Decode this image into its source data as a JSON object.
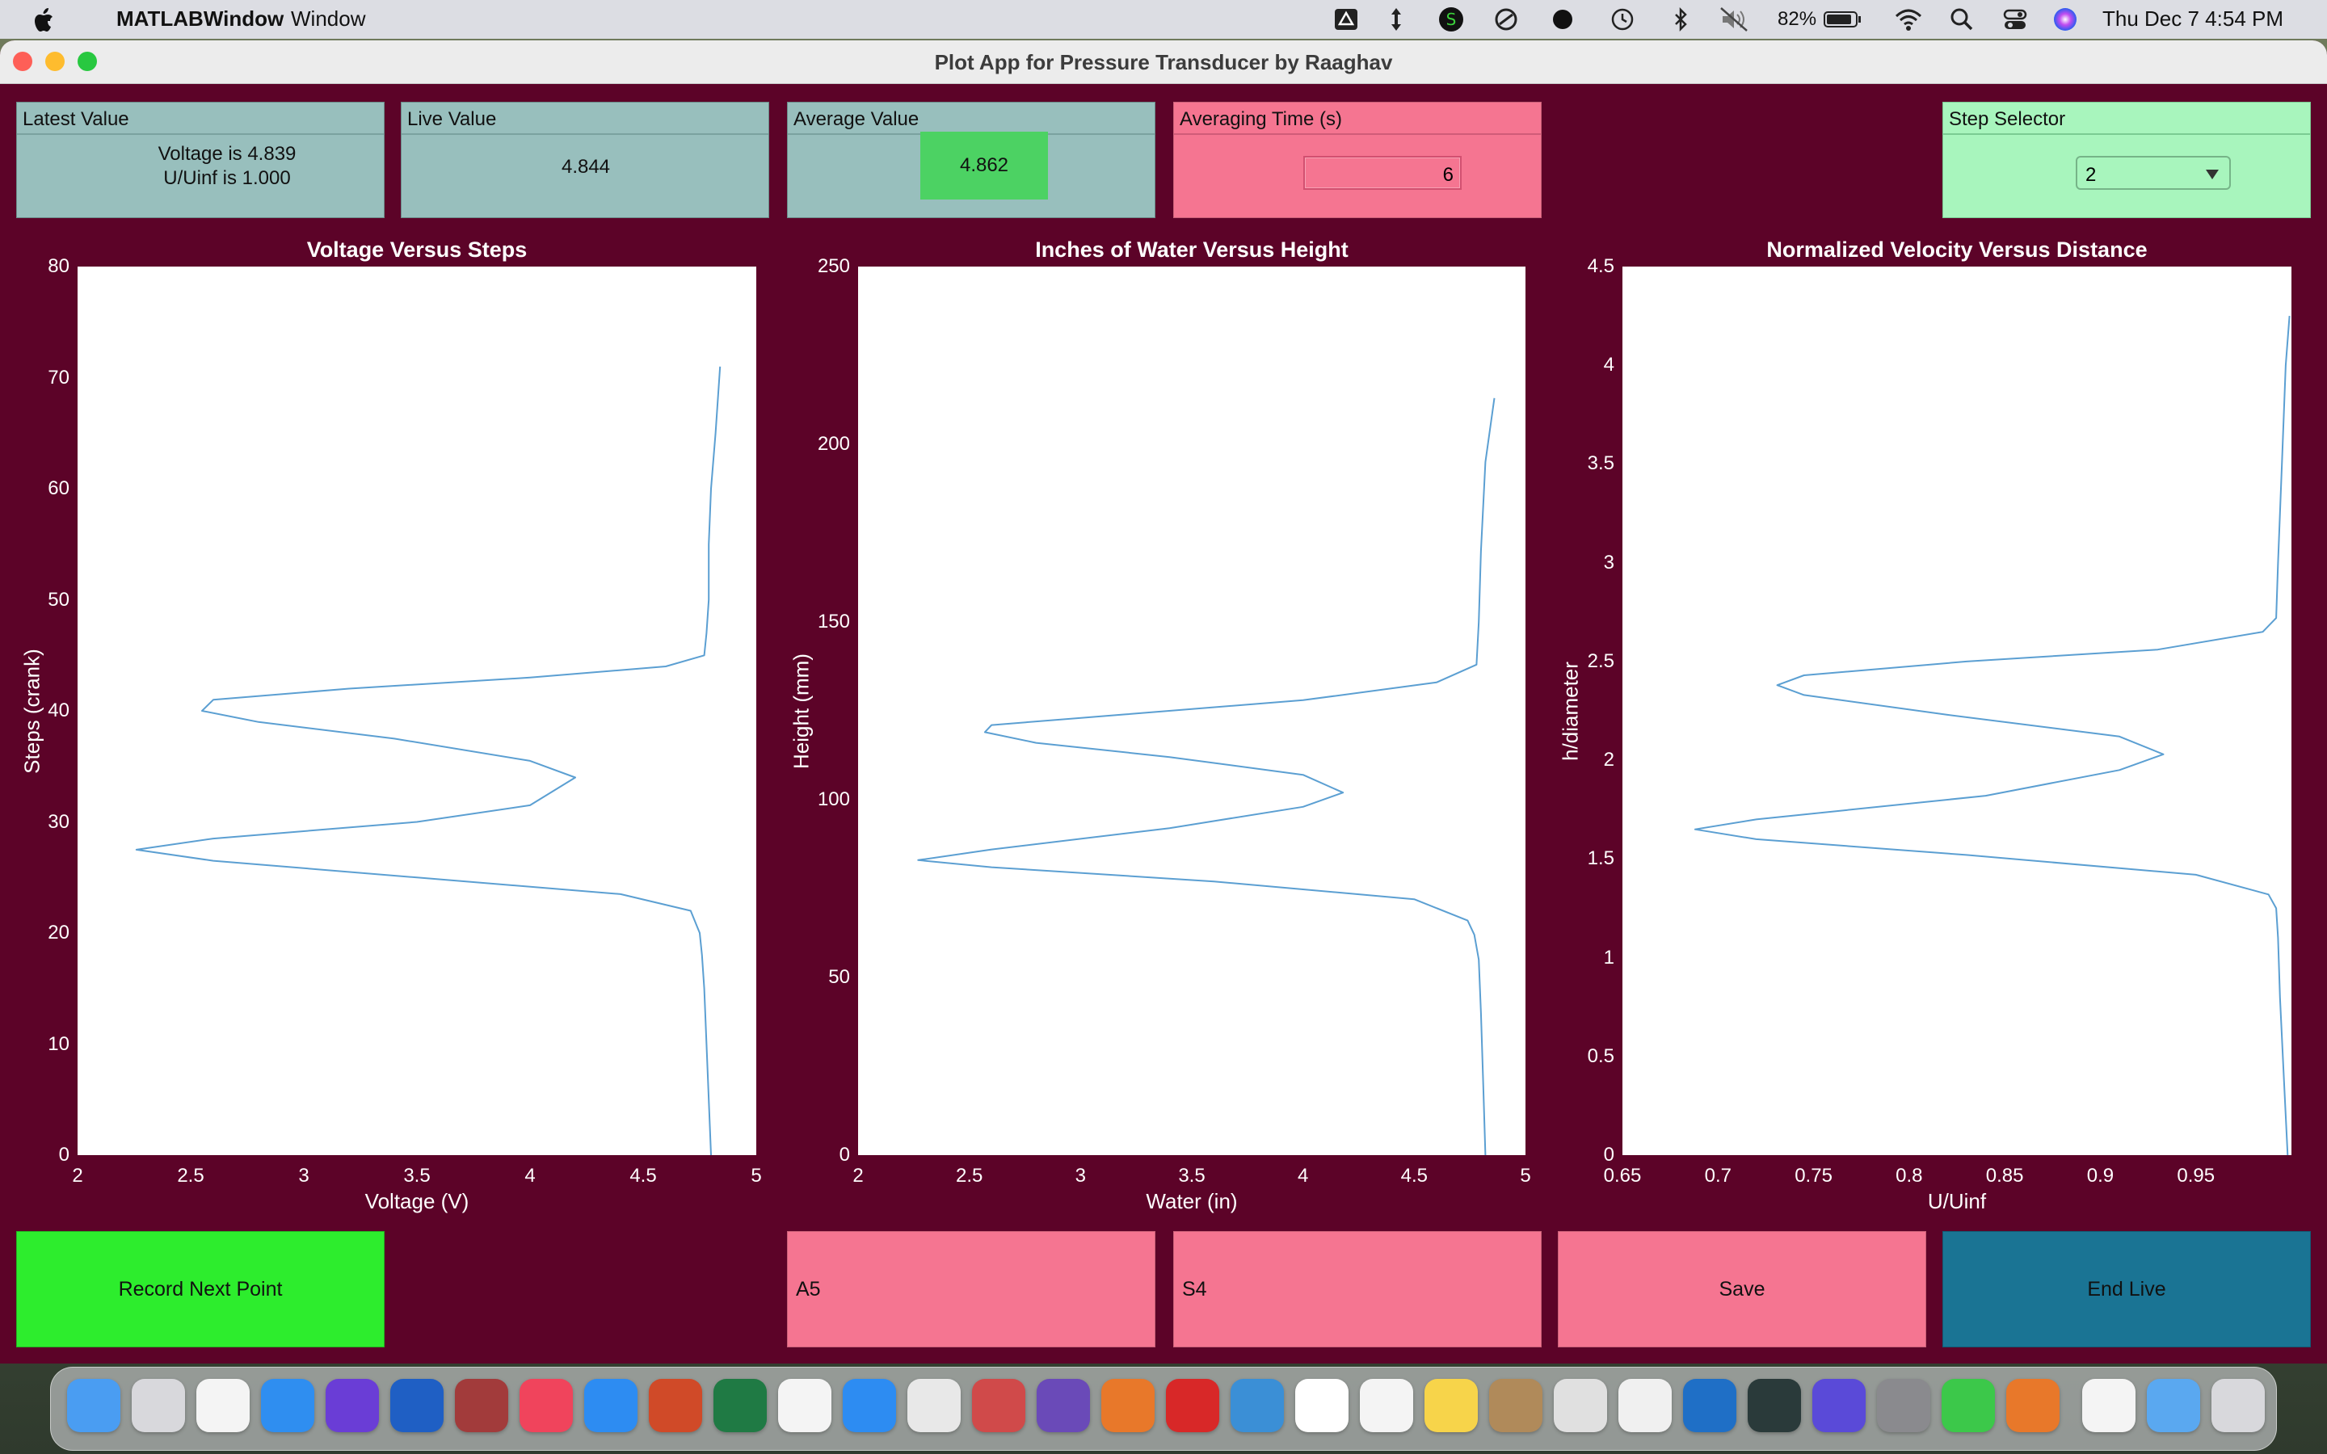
{
  "menubar": {
    "app_name": "MATLABWindow",
    "menu_window": "Window",
    "battery": "82%",
    "datetime": "Thu Dec 7  4:54 PM"
  },
  "window": {
    "title": "Plot App for Pressure Transducer by Raaghav"
  },
  "panels": {
    "latest": {
      "title": "Latest Value",
      "line1": "Voltage is 4.839",
      "line2": "U/Uinf is 1.000"
    },
    "live": {
      "title": "Live Value",
      "value": "4.844"
    },
    "average": {
      "title": "Average Value",
      "value": "4.862"
    },
    "averaging": {
      "title": "Averaging Time (s)",
      "value": "6"
    },
    "step": {
      "title": "Step Selector",
      "value": "2"
    }
  },
  "buttons": {
    "record": "Record Next Point",
    "a5": "A5",
    "s4": "S4",
    "save": "Save",
    "end_live": "End Live"
  },
  "colors": {
    "window_bg": "#5c0328",
    "teal_panel": "#98bfbd",
    "pink_panel": "#f57591",
    "mint_panel": "#a8f5bd",
    "green_button": "#2ded2d",
    "blue_button": "#1a7494",
    "line": "#5b9fd2"
  },
  "chart_data": [
    {
      "type": "line",
      "title": "Voltage Versus Steps",
      "xlabel": "Voltage (V)",
      "ylabel": "Steps (crank)",
      "xlim": [
        2,
        5
      ],
      "ylim": [
        0,
        80
      ],
      "xticks": [
        "2",
        "2.5",
        "3",
        "3.5",
        "4",
        "4.5",
        "5"
      ],
      "yticks": [
        "0",
        "10",
        "20",
        "30",
        "40",
        "50",
        "60",
        "70",
        "80"
      ],
      "x": [
        4.8,
        4.79,
        4.78,
        4.77,
        4.76,
        4.75,
        4.73,
        4.71,
        4.4,
        3.5,
        2.6,
        2.26,
        2.6,
        3.5,
        4.0,
        4.2,
        4.0,
        3.4,
        2.8,
        2.55,
        2.6,
        3.2,
        4.0,
        4.6,
        4.77,
        4.78,
        4.79,
        4.79,
        4.8,
        4.82,
        4.84
      ],
      "y": [
        0,
        5,
        10,
        15,
        18,
        20,
        21,
        22,
        23.5,
        25,
        26.5,
        27.5,
        28.5,
        30,
        31.5,
        34,
        35.5,
        37.5,
        39,
        40,
        41,
        42,
        43,
        44,
        45,
        47,
        50,
        55,
        60,
        65,
        71
      ]
    },
    {
      "type": "line",
      "title": "Inches of Water Versus Height",
      "xlabel": "Water (in)",
      "ylabel": "Height (mm)",
      "xlim": [
        2,
        5
      ],
      "ylim": [
        0,
        250
      ],
      "xticks": [
        "2",
        "2.5",
        "3",
        "3.5",
        "4",
        "4.5",
        "5"
      ],
      "yticks": [
        "0",
        "50",
        "100",
        "150",
        "200",
        "250"
      ],
      "x": [
        4.82,
        4.81,
        4.8,
        4.79,
        4.77,
        4.74,
        4.5,
        3.6,
        2.6,
        2.27,
        2.6,
        3.4,
        4.0,
        4.18,
        4.0,
        3.4,
        2.8,
        2.57,
        2.6,
        3.2,
        4.0,
        4.6,
        4.78,
        4.79,
        4.8,
        4.82,
        4.86
      ],
      "y": [
        0,
        20,
        40,
        55,
        62,
        66,
        72,
        77,
        81,
        83,
        86,
        92,
        98,
        102,
        107,
        112,
        116,
        119,
        121,
        124,
        128,
        133,
        138,
        150,
        170,
        195,
        213
      ]
    },
    {
      "type": "line",
      "title": "Normalized Velocity Versus Distance",
      "xlabel": "U/Uinf",
      "ylabel": "h/diameter",
      "xlim": [
        0.65,
        1.0
      ],
      "ylim": [
        0,
        4.5
      ],
      "xticks": [
        "0.65",
        "0.7",
        "0.75",
        "0.8",
        "0.85",
        "0.9",
        "0.95"
      ],
      "yticks": [
        "0",
        "0.5",
        "1",
        "1.5",
        "2",
        "2.5",
        "3",
        "3.5",
        "4",
        "4.5"
      ],
      "x": [
        0.998,
        0.996,
        0.994,
        0.993,
        0.992,
        0.988,
        0.95,
        0.83,
        0.72,
        0.688,
        0.72,
        0.84,
        0.91,
        0.933,
        0.91,
        0.82,
        0.745,
        0.731,
        0.745,
        0.83,
        0.93,
        0.985,
        0.992,
        0.993,
        0.995,
        0.997,
        0.999
      ],
      "y": [
        0,
        0.4,
        0.8,
        1.1,
        1.25,
        1.32,
        1.42,
        1.52,
        1.6,
        1.65,
        1.7,
        1.82,
        1.95,
        2.03,
        2.12,
        2.23,
        2.33,
        2.38,
        2.43,
        2.5,
        2.56,
        2.65,
        2.72,
        3.0,
        3.5,
        4.0,
        4.25
      ]
    }
  ]
}
